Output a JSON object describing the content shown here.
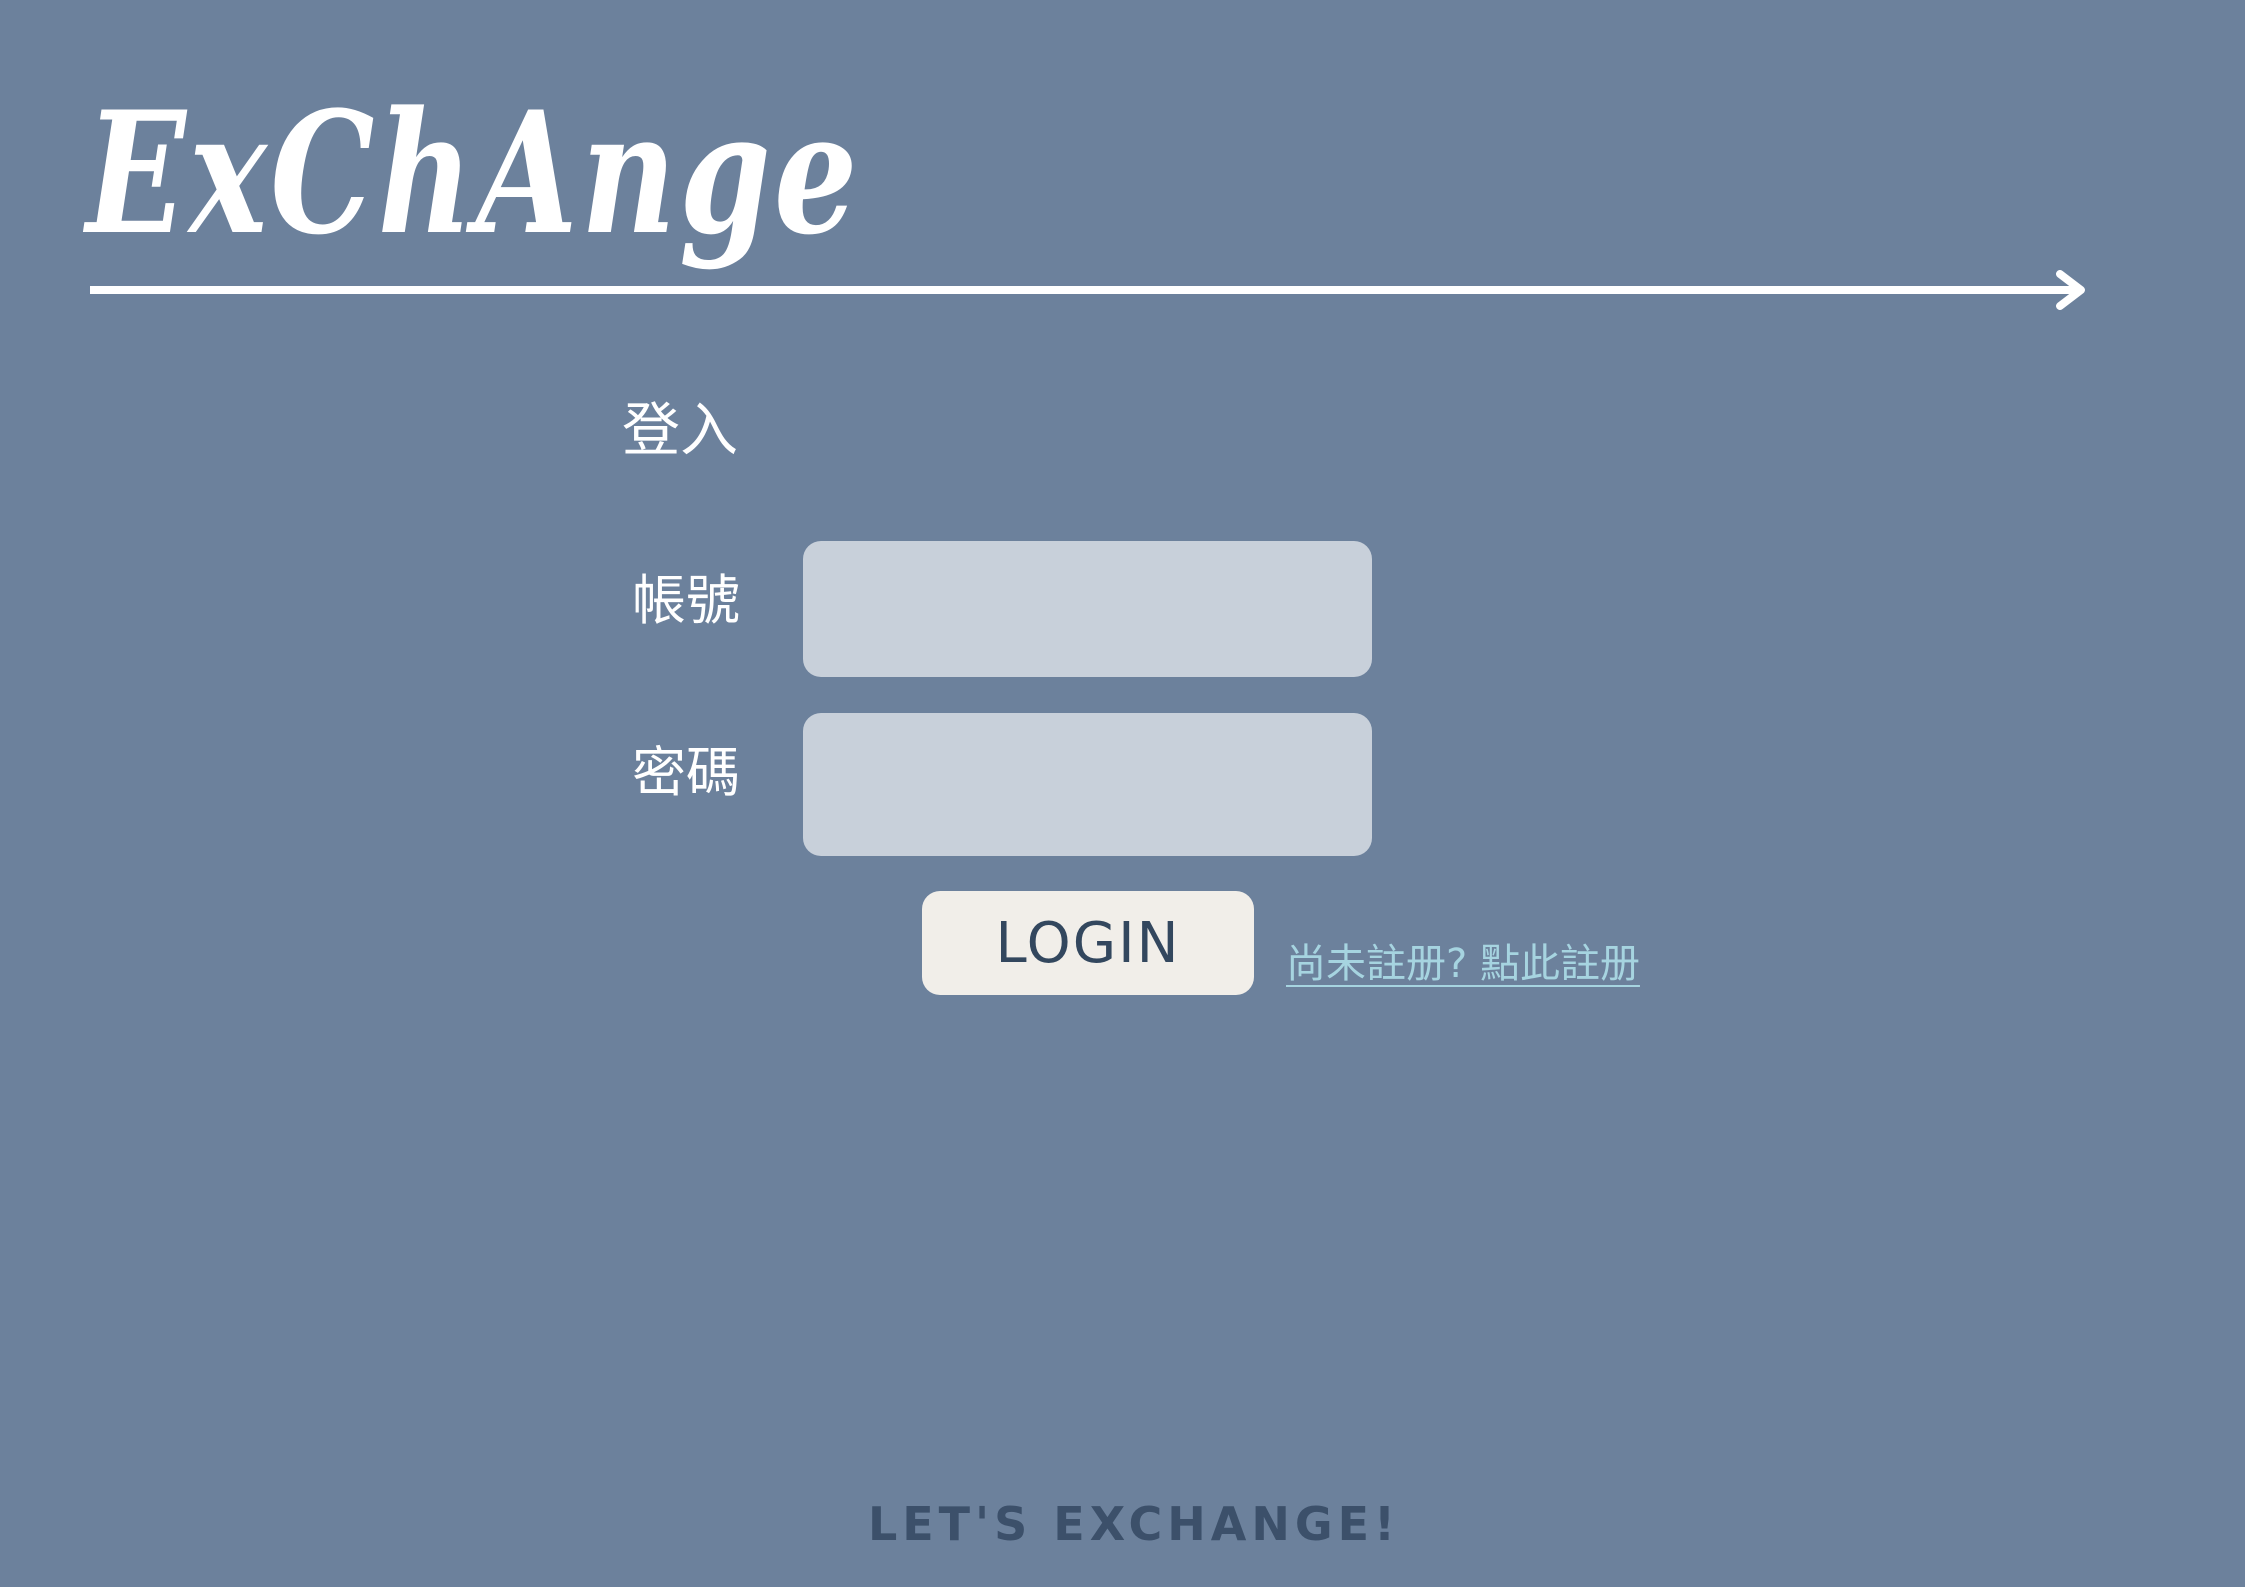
{
  "brand": {
    "logo_text": "ExChAnge"
  },
  "login": {
    "title": "登入",
    "account_label": "帳號",
    "account_value": "",
    "password_label": "密碼",
    "password_value": "",
    "button_label": "LOGIN",
    "register_link": "尚未註册? 點此註册"
  },
  "footer": {
    "tagline": "LET'S EXCHANGE!"
  },
  "colors": {
    "background": "#6c819c",
    "input_fill": "#c8d0da",
    "button_fill": "#f1eee9",
    "link": "#a6d4e0",
    "footer_text": "#3c506a"
  },
  "icons": {
    "divider": "arrow-right-icon"
  }
}
